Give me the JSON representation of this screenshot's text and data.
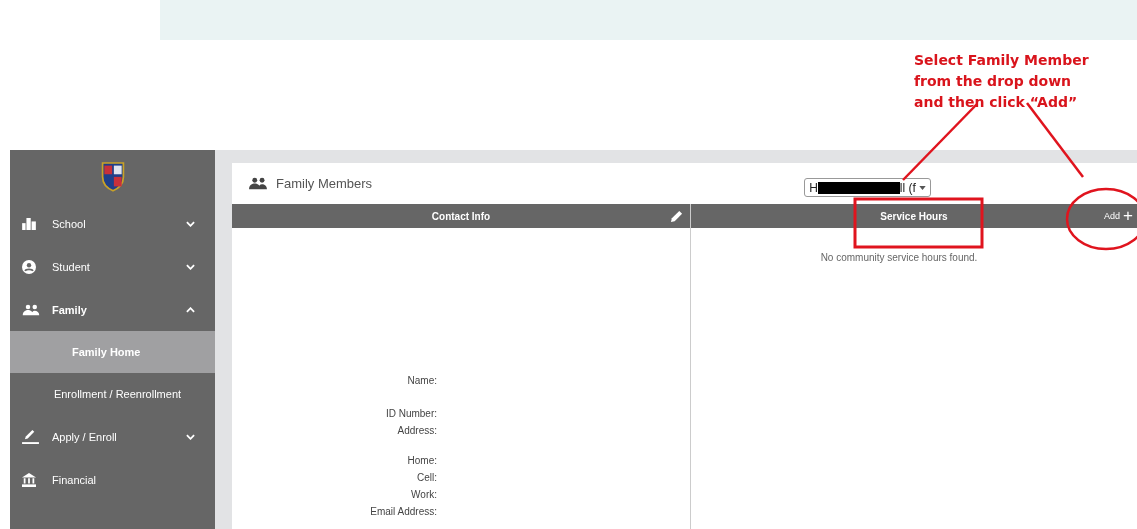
{
  "callout": {
    "lines": [
      "Select Family Member",
      "from the drop down",
      "and then click  “Add”"
    ]
  },
  "sidebar": {
    "items": [
      {
        "label": "School",
        "expanded": false,
        "selected": false
      },
      {
        "label": "Student",
        "expanded": false,
        "selected": false
      },
      {
        "label": "Family",
        "expanded": true,
        "selected": false,
        "children": [
          {
            "label": "Family Home",
            "selected": true
          },
          {
            "label": "Enrollment / Reenrollment",
            "selected": false
          }
        ]
      },
      {
        "label": "Apply / Enroll",
        "expanded": false,
        "selected": false
      },
      {
        "label": "Financial",
        "selected": false
      }
    ]
  },
  "panel": {
    "title": "Family Members",
    "member_select": {
      "value_start": "H",
      "value_end": "ll (f"
    }
  },
  "contact": {
    "heading": "Contact Info",
    "fields": [
      {
        "label": "Name:"
      },
      {
        "label": "ID Number:"
      },
      {
        "label": "Address:"
      },
      {
        "label": "Home:"
      },
      {
        "label": "Cell:"
      },
      {
        "label": "Work:"
      },
      {
        "label": "Email Address:"
      }
    ]
  },
  "service": {
    "heading": "Service Hours",
    "add_label": "Add",
    "add_icon": "+",
    "empty_message": "No community service hours found."
  }
}
